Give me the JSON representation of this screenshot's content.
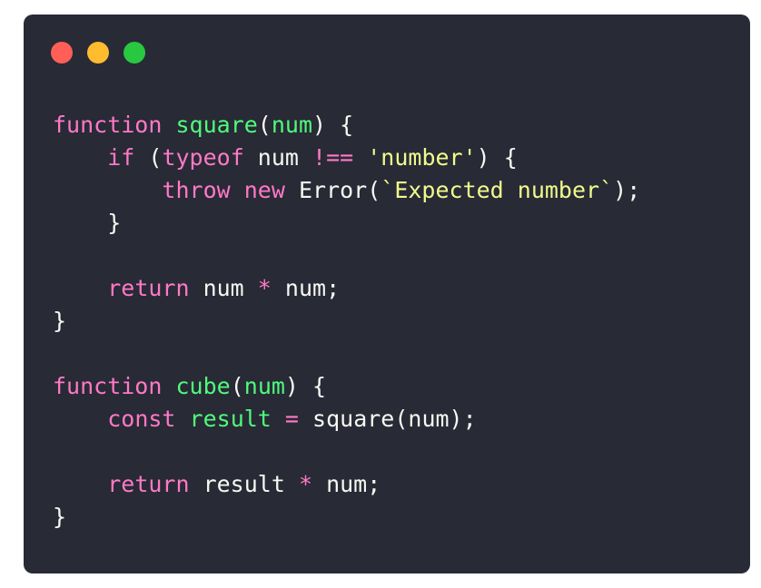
{
  "window": {
    "background": "#282a36",
    "buttons": [
      {
        "name": "close-button",
        "color": "#ff5f57"
      },
      {
        "name": "minimize-button",
        "color": "#febc2e"
      },
      {
        "name": "maximize-button",
        "color": "#28c840"
      }
    ]
  },
  "colors": {
    "keyword": "#ff79c6",
    "function": "#50fa7b",
    "param": "#50fa7b",
    "string": "#f1fa8c",
    "plain": "#f8f8f2",
    "operator": "#ff79c6"
  },
  "code": {
    "lines": [
      [
        {
          "t": "function",
          "c": "keyword"
        },
        {
          "t": " ",
          "c": "plain"
        },
        {
          "t": "square",
          "c": "function"
        },
        {
          "t": "(",
          "c": "plain"
        },
        {
          "t": "num",
          "c": "param"
        },
        {
          "t": ") {",
          "c": "plain"
        }
      ],
      [
        {
          "t": "    ",
          "c": "plain"
        },
        {
          "t": "if",
          "c": "keyword"
        },
        {
          "t": " (",
          "c": "plain"
        },
        {
          "t": "typeof",
          "c": "keyword"
        },
        {
          "t": " num ",
          "c": "plain"
        },
        {
          "t": "!==",
          "c": "operator"
        },
        {
          "t": " ",
          "c": "plain"
        },
        {
          "t": "'number'",
          "c": "string"
        },
        {
          "t": ") {",
          "c": "plain"
        }
      ],
      [
        {
          "t": "        ",
          "c": "plain"
        },
        {
          "t": "throw",
          "c": "keyword"
        },
        {
          "t": " ",
          "c": "plain"
        },
        {
          "t": "new",
          "c": "keyword"
        },
        {
          "t": " Error(",
          "c": "plain"
        },
        {
          "t": "`Expected number`",
          "c": "string"
        },
        {
          "t": ");",
          "c": "plain"
        }
      ],
      [
        {
          "t": "    }",
          "c": "plain"
        }
      ],
      [],
      [
        {
          "t": "    ",
          "c": "plain"
        },
        {
          "t": "return",
          "c": "keyword"
        },
        {
          "t": " num ",
          "c": "plain"
        },
        {
          "t": "*",
          "c": "operator"
        },
        {
          "t": " num;",
          "c": "plain"
        }
      ],
      [
        {
          "t": "}",
          "c": "plain"
        }
      ],
      [],
      [
        {
          "t": "function",
          "c": "keyword"
        },
        {
          "t": " ",
          "c": "plain"
        },
        {
          "t": "cube",
          "c": "function"
        },
        {
          "t": "(",
          "c": "plain"
        },
        {
          "t": "num",
          "c": "param"
        },
        {
          "t": ") {",
          "c": "plain"
        }
      ],
      [
        {
          "t": "    ",
          "c": "plain"
        },
        {
          "t": "const",
          "c": "keyword"
        },
        {
          "t": " ",
          "c": "plain"
        },
        {
          "t": "result",
          "c": "function"
        },
        {
          "t": " ",
          "c": "plain"
        },
        {
          "t": "=",
          "c": "operator"
        },
        {
          "t": " square(num);",
          "c": "plain"
        }
      ],
      [],
      [
        {
          "t": "    ",
          "c": "plain"
        },
        {
          "t": "return",
          "c": "keyword"
        },
        {
          "t": " result ",
          "c": "plain"
        },
        {
          "t": "*",
          "c": "operator"
        },
        {
          "t": " num;",
          "c": "plain"
        }
      ],
      [
        {
          "t": "}",
          "c": "plain"
        }
      ]
    ]
  }
}
